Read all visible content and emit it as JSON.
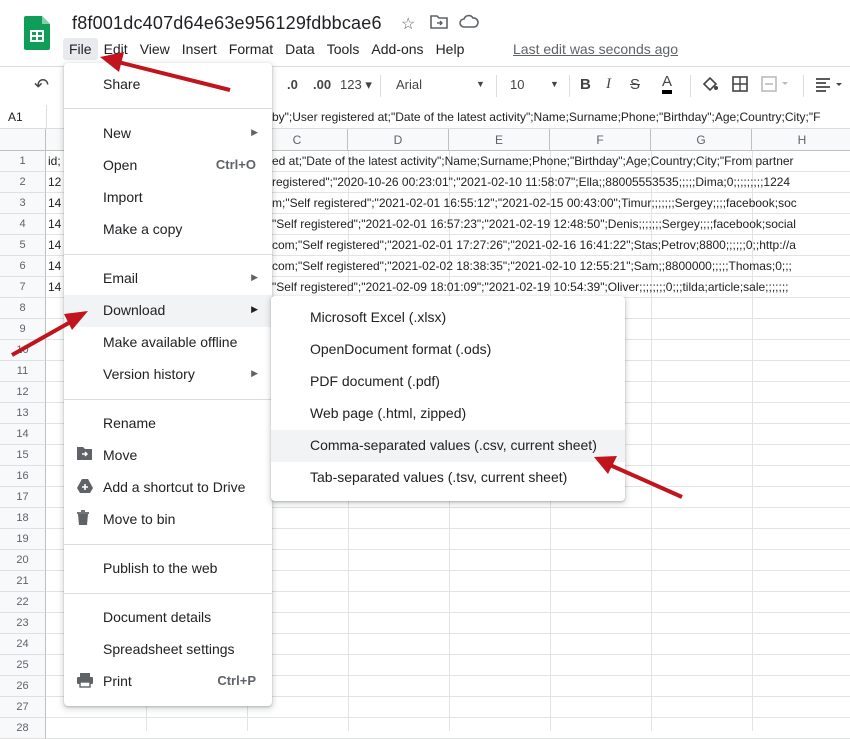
{
  "doc": {
    "title": "f8f001dc407d64e63e956129fdbbcae6",
    "last_edit": "Last edit was seconds ago"
  },
  "menubar": [
    "File",
    "Edit",
    "View",
    "Insert",
    "Format",
    "Data",
    "Tools",
    "Add-ons",
    "Help"
  ],
  "toolbar": {
    "decimal_less": ".0",
    "decimal_more": ".00",
    "format_more": "123",
    "font": "Arial",
    "font_size": "10",
    "bold": "B",
    "italic": "I",
    "strike": "S",
    "text_color": "A"
  },
  "formula": {
    "cell_ref": "A1",
    "content": "by\";User registered at;\"Date of the latest activity\";Name;Surname;Phone;\"Birthday\";Age;Country;City;\"F"
  },
  "columns": [
    "C",
    "D",
    "E",
    "F",
    "G",
    "H"
  ],
  "rows": [
    "1",
    "2",
    "3",
    "4",
    "5",
    "6",
    "7",
    "8",
    "9",
    "10",
    "11",
    "12",
    "13",
    "14",
    "15",
    "16",
    "17",
    "18",
    "19",
    "20",
    "21",
    "22",
    "23",
    "24",
    "25",
    "26",
    "27",
    "28"
  ],
  "cells": {
    "a": [
      "id;",
      "12",
      "14",
      "14",
      "14",
      "14",
      "14"
    ],
    "wide": [
      "ed at;\"Date of the latest activity\";Name;Surname;Phone;\"Birthday\";Age;Country;City;\"From partner",
      " registered\";\"2020-10-26 00:23:01\";\"2021-02-10 11:58:07\";Ella;;88005553535;;;;;Dima;0;;;;;;;;;1224",
      "m;\"Self registered\";\"2021-02-01 16:55:12\";\"2021-02-15 00:43:00\";Timur;;;;;;;Sergey;;;;facebook;soc",
      "\"Self registered\";\"2021-02-01 16:57:23\";\"2021-02-19 12:48:50\";Denis;;;;;;;Sergey;;;;facebook;social",
      "com;\"Self registered\";\"2021-02-01 17:27:26\";\"2021-02-16 16:41:22\";Stas;Petrov;8800;;;;;;0;;http://a",
      "com;\"Self registered\";\"2021-02-02 18:38:35\";\"2021-02-10 12:55:21\";Sam;;8800000;;;;;Thomas;0;;;",
      "\"Self registered\";\"2021-02-09 18:01:09\";\"2021-02-19 10:54:39\";Oliver;;;;;;;;0;;;tilda;article;sale;;;;;;;"
    ]
  },
  "file_menu": {
    "share": "Share",
    "new": "New",
    "open": "Open",
    "open_sc": "Ctrl+O",
    "import": "Import",
    "copy": "Make a copy",
    "email": "Email",
    "download": "Download",
    "offline": "Make available offline",
    "version": "Version history",
    "rename": "Rename",
    "move": "Move",
    "shortcut": "Add a shortcut to Drive",
    "bin": "Move to bin",
    "publish": "Publish to the web",
    "details": "Document details",
    "settings": "Spreadsheet settings",
    "print": "Print",
    "print_sc": "Ctrl+P"
  },
  "download_menu": [
    "Microsoft Excel (.xlsx)",
    "OpenDocument format (.ods)",
    "PDF document (.pdf)",
    "Web page (.html, zipped)",
    "Comma-separated values (.csv, current sheet)",
    "Tab-separated values (.tsv, current sheet)"
  ],
  "colors": {
    "accent_green": "#0f9d58",
    "arrow_red": "#c0151c",
    "highlight": "#f1f3f4"
  }
}
